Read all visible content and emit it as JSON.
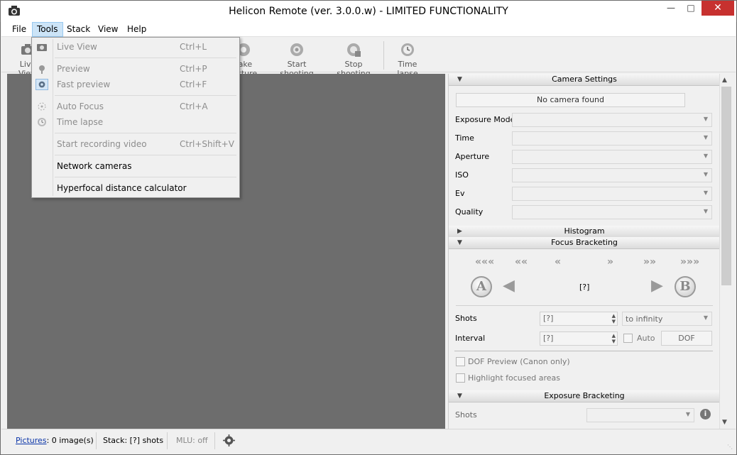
{
  "window": {
    "title": "Helicon Remote (ver. 3.0.0.w) - LIMITED FUNCTIONALITY"
  },
  "menubar": {
    "items": [
      "File",
      "Tools",
      "Stack",
      "View",
      "Help"
    ]
  },
  "toolbar": {
    "buttons": [
      {
        "label": "Live View",
        "icon": "camera-icon"
      },
      {
        "label": "Take picture",
        "icon": "shutter-icon"
      },
      {
        "label": "Start shooting",
        "icon": "gear-icon"
      },
      {
        "label": "Stop shooting",
        "icon": "stop-gear-icon"
      },
      {
        "label": "Time lapse",
        "icon": "clock-icon"
      }
    ]
  },
  "tools_menu": {
    "items": [
      {
        "label": "Live View",
        "shortcut": "Ctrl+L",
        "icon": "live-view-icon",
        "disabled": true
      },
      {
        "label": "Preview",
        "shortcut": "Ctrl+P",
        "icon": "preview-icon",
        "disabled": true
      },
      {
        "label": "Fast preview",
        "shortcut": "Ctrl+F",
        "icon": "fast-preview-icon",
        "disabled": true
      },
      {
        "label": "Auto Focus",
        "shortcut": "Ctrl+A",
        "icon": "autofocus-icon",
        "disabled": true
      },
      {
        "label": "Time lapse",
        "shortcut": "",
        "icon": "clock-icon",
        "disabled": true
      },
      {
        "label": "Start recording video",
        "shortcut": "Ctrl+Shift+V",
        "icon": "",
        "disabled": true
      },
      {
        "label": "Network cameras",
        "shortcut": "",
        "icon": "",
        "disabled": false
      },
      {
        "label": "Hyperfocal distance calculator",
        "shortcut": "",
        "icon": "",
        "disabled": false
      }
    ]
  },
  "camera_settings": {
    "header": "Camera Settings",
    "status": "No camera found",
    "rows": [
      "Exposure Mode",
      "Time",
      "Aperture",
      "ISO",
      "Ev",
      "Quality"
    ]
  },
  "histogram": {
    "header": "Histogram"
  },
  "focus_bracketing": {
    "header": "Focus Bracketing",
    "nav": [
      "«««",
      "««",
      "«",
      "»",
      "»»",
      "»»»"
    ],
    "btn_a": "A",
    "btn_b": "B",
    "position": "[?]",
    "shots_label": "Shots",
    "shots_value": "[?]",
    "range_value": "to infinity",
    "interval_label": "Interval",
    "interval_value": "[?]",
    "auto_label": "Auto",
    "dof_button": "DOF",
    "dof_preview": "DOF Preview (Canon only)",
    "highlight": "Highlight focused areas"
  },
  "exposure_bracketing": {
    "header": "Exposure Bracketing",
    "shots_label": "Shots"
  },
  "statusbar": {
    "pictures_link": "Pictures",
    "pictures_count": ": 0 image(s)",
    "stack": "Stack: [?] shots",
    "mlu": "MLU: off"
  }
}
